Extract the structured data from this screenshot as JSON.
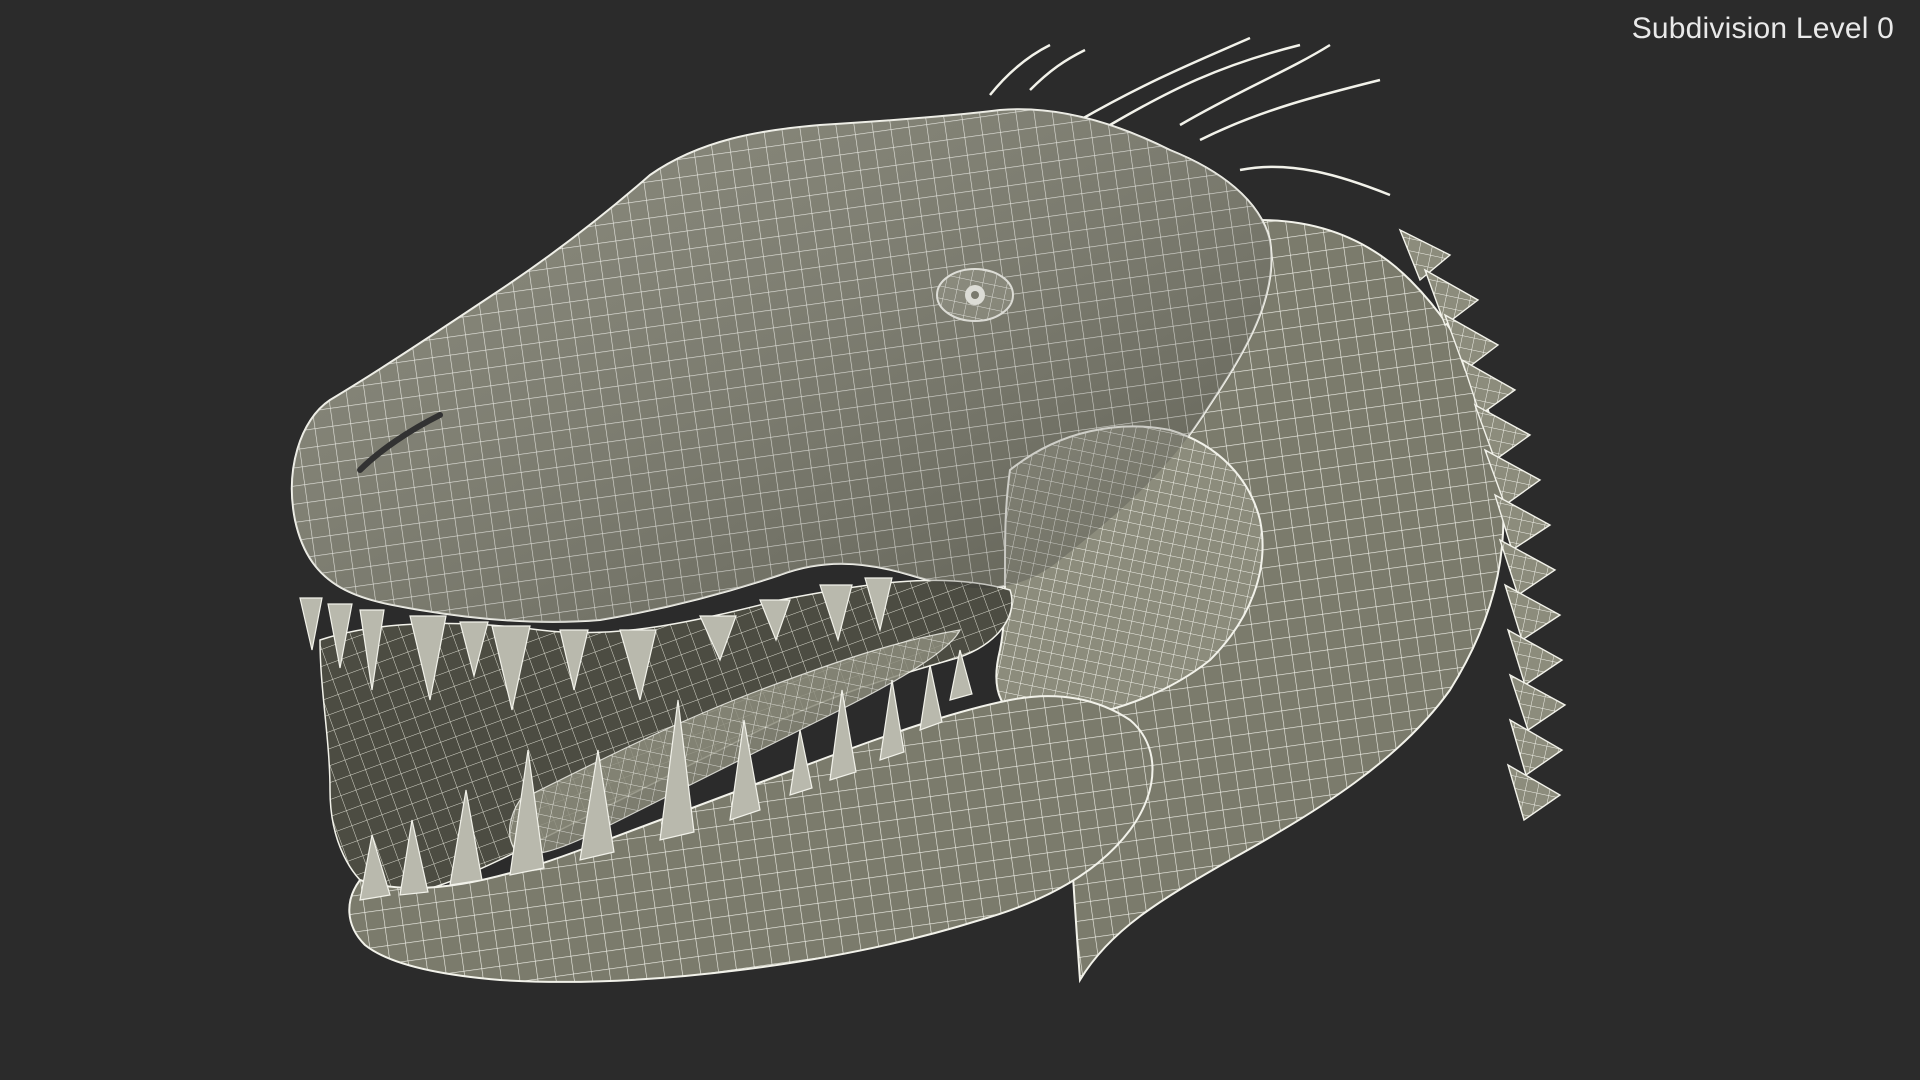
{
  "overlay": {
    "label": "Subdivision Level 0"
  },
  "render": {
    "background_color": "#2b2b2b",
    "model_fill": "#7b7b6c",
    "model_fill_light": "#8c8c7c",
    "model_shadow": "#4c4c42",
    "mouth_interior": "#3c3c34",
    "wire_color": "#f2f2ea",
    "teeth_fill": "#b9b9ad"
  }
}
